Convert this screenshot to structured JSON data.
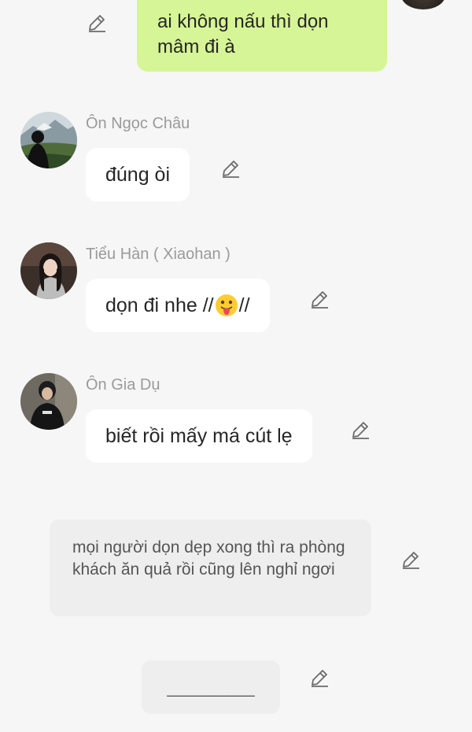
{
  "own_message": {
    "text": "ai không nấu thì dọn mâm đi à"
  },
  "messages": [
    {
      "sender": "Ôn Ngọc Châu",
      "text": "đúng òi"
    },
    {
      "sender": "Tiểu Hàn ( Xiaohan )",
      "text_before_emoji": "dọn đi nhe //",
      "emoji": "tongue-out-emoji",
      "text_after_emoji": "//"
    },
    {
      "sender": "Ôn Gia Dụ",
      "text": "biết rồi mấy má cút lẹ"
    }
  ],
  "narration": {
    "text": "mọi người dọn dẹp xong thì ra phòng khách ăn quả rồi cũng lên nghỉ ngơi"
  },
  "divider": {
    "text": "__________"
  },
  "icons": {
    "edit": "pencil-edit-icon"
  },
  "colors": {
    "background": "#f6f6f6",
    "own_bubble": "#d6f596",
    "incoming_bubble": "#ffffff",
    "narration_bubble": "#eeeeee",
    "sender_name": "#9a9a9a",
    "edit_icon": "#6b6b6b"
  }
}
